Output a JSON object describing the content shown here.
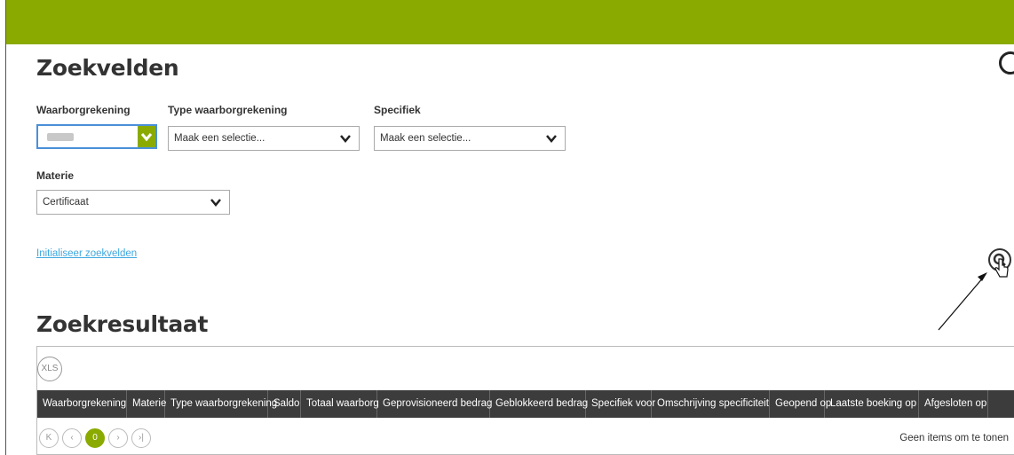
{
  "search_section": {
    "title": "Zoekvelden",
    "fields": [
      {
        "label": "Waarborgrekening",
        "value": ""
      },
      {
        "label": "Type waarborgrekening",
        "value": "Maak een selectie..."
      },
      {
        "label": "Specifiek",
        "value": "Maak een selectie..."
      },
      {
        "label": "Materie",
        "value": "Certificaat"
      }
    ],
    "reset_link": "Initialiseer zoekvelden"
  },
  "results_section": {
    "title": "Zoekresultaat",
    "export_label": "XLS",
    "columns": [
      "Waarborgrekening",
      "Materie",
      "Type waarborgrekening",
      "Saldo",
      "Totaal waarborg",
      "Geprovisioneerd bedrag",
      "Geblokkeerd bedrag",
      "Specifiek voor",
      "Omschrijving specificiteit",
      "Geopend op",
      "Laatste boeking op",
      "Afgesloten op"
    ],
    "pager": {
      "first": "K",
      "prev": "‹",
      "current": "0",
      "next": "›",
      "last": "›|"
    },
    "empty_text": "Geen items om te tonen"
  },
  "colors": {
    "accent": "#8aaa00",
    "header_bg": "#3c3c3c",
    "link": "#3fa8e0"
  },
  "icons": [
    "search-icon",
    "chevron-down-icon",
    "xls-icon",
    "cursor-hand-icon"
  ]
}
